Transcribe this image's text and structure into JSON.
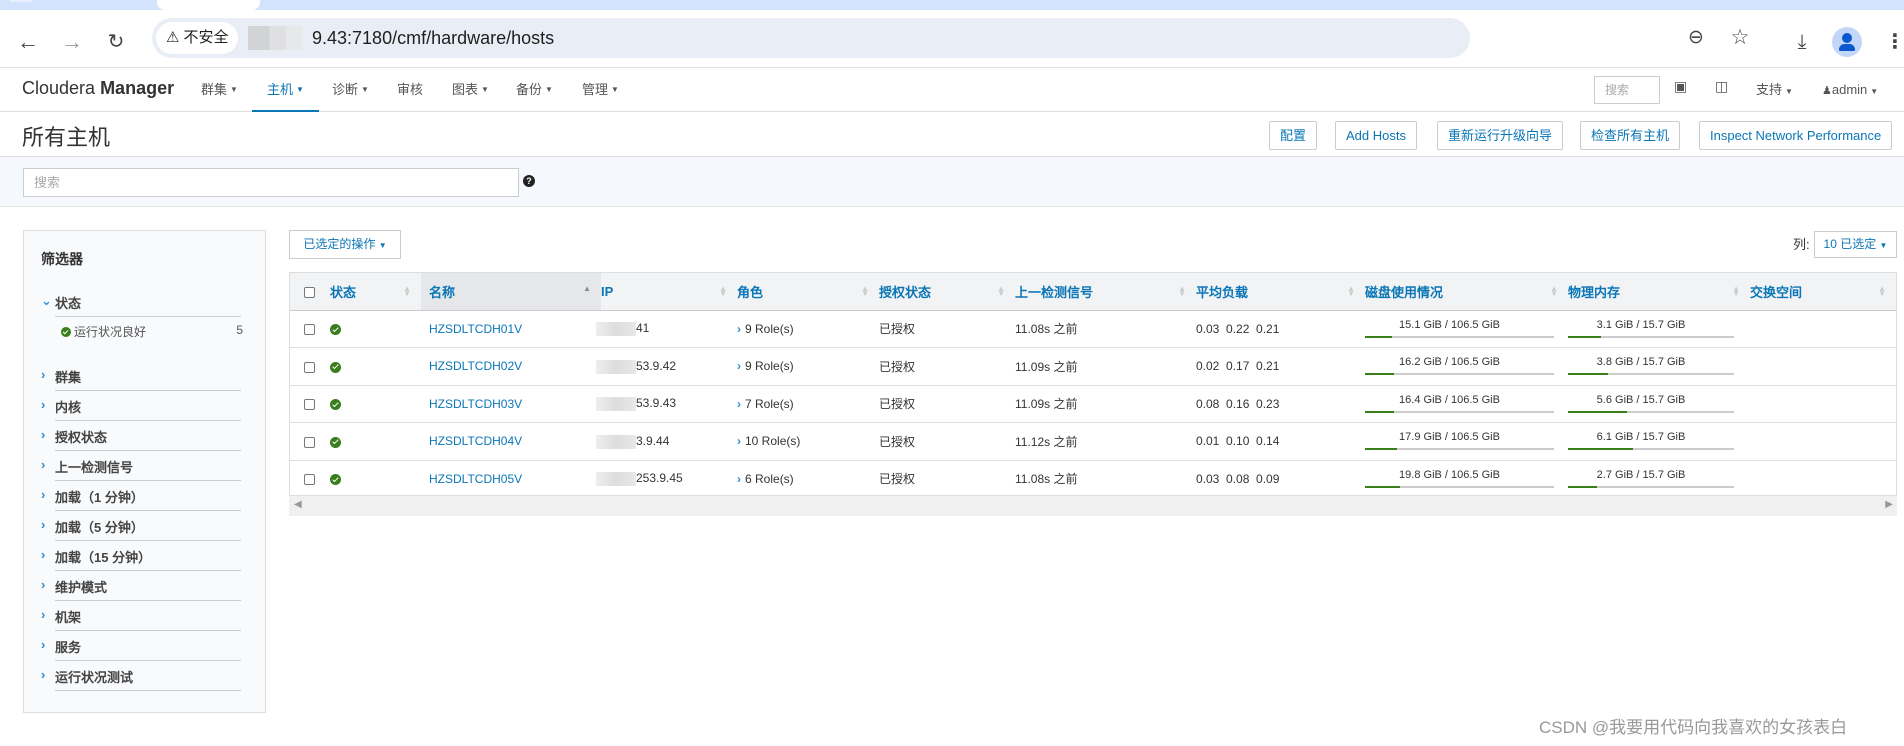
{
  "browser": {
    "security_label": "不安全",
    "url": "9.43:7180/cmf/hardware/hosts",
    "icons": [
      "back-icon",
      "forward-icon",
      "reload-icon",
      "warning-icon",
      "zoom-out-icon",
      "star-icon",
      "download-icon",
      "profile-icon",
      "more-menu-icon"
    ]
  },
  "nav": {
    "brand_light": "Cloudera",
    "brand_bold": "Manager",
    "menus": [
      {
        "label": "群集",
        "dropdown": true
      },
      {
        "label": "主机",
        "dropdown": true,
        "active": true
      },
      {
        "label": "诊断",
        "dropdown": true
      },
      {
        "label": "审核",
        "dropdown": false
      },
      {
        "label": "图表",
        "dropdown": true
      },
      {
        "label": "备份",
        "dropdown": true
      },
      {
        "label": "管理",
        "dropdown": true
      }
    ],
    "search_placeholder": "搜索",
    "support_label": "支持",
    "user_label": "admin",
    "accent_color": "#0a76b6"
  },
  "page": {
    "title": "所有主机",
    "buttons": [
      "配置",
      "Add Hosts",
      "重新运行升级向导",
      "检查所有主机",
      "Inspect Network Performance"
    ],
    "search_placeholder": "搜索",
    "help_glyph": "?"
  },
  "filters": {
    "title": "筛选器",
    "status_group": "状态",
    "status_item": {
      "label": "运行状况良好",
      "count": "5"
    },
    "groups": [
      "群集",
      "内核",
      "授权状态",
      "上一检测信号",
      "加载（1 分钟）",
      "加载（5 分钟）",
      "加载（15 分钟）",
      "维护模式",
      "机架",
      "服务",
      "运行状况测试"
    ]
  },
  "toolbar": {
    "actions_label": "已选定的操作",
    "columns_label": "列:",
    "columns_value": "10 已选定"
  },
  "table": {
    "headers": [
      "状态",
      "名称",
      "IP",
      "角色",
      "授权状态",
      "上一检测信号",
      "平均负载",
      "磁盘使用情况",
      "物理内存",
      "交换空间"
    ],
    "rows": [
      {
        "name": "HZSDLTCDH01V",
        "ip": "41",
        "roles": "9 Role(s)",
        "auth": "已授权",
        "heartbeat": "11.08s 之前",
        "load": "0.03  0.22  0.21",
        "disk": "15.1 GiB / 106.5 GiB",
        "disk_frac": 0.142,
        "mem": "3.1 GiB / 15.7 GiB",
        "mem_frac": 0.197
      },
      {
        "name": "HZSDLTCDH02V",
        "ip": "53.9.42",
        "roles": "9 Role(s)",
        "auth": "已授权",
        "heartbeat": "11.09s 之前",
        "load": "0.02  0.17  0.21",
        "disk": "16.2 GiB / 106.5 GiB",
        "disk_frac": 0.152,
        "mem": "3.8 GiB / 15.7 GiB",
        "mem_frac": 0.242
      },
      {
        "name": "HZSDLTCDH03V",
        "ip": "53.9.43",
        "roles": "7 Role(s)",
        "auth": "已授权",
        "heartbeat": "11.09s 之前",
        "load": "0.08  0.16  0.23",
        "disk": "16.4 GiB / 106.5 GiB",
        "disk_frac": 0.154,
        "mem": "5.6 GiB / 15.7 GiB",
        "mem_frac": 0.357
      },
      {
        "name": "HZSDLTCDH04V",
        "ip": "3.9.44",
        "roles": "10 Role(s)",
        "auth": "已授权",
        "heartbeat": "11.12s 之前",
        "load": "0.01  0.10  0.14",
        "disk": "17.9 GiB / 106.5 GiB",
        "disk_frac": 0.168,
        "mem": "6.1 GiB / 15.7 GiB",
        "mem_frac": 0.389
      },
      {
        "name": "HZSDLTCDH05V",
        "ip": "253.9.45",
        "roles": "6 Role(s)",
        "auth": "已授权",
        "heartbeat": "11.08s 之前",
        "load": "0.03  0.08  0.09",
        "disk": "19.8 GiB / 106.5 GiB",
        "disk_frac": 0.186,
        "mem": "2.7 GiB / 15.7 GiB",
        "mem_frac": 0.172
      }
    ],
    "healthy_color": "#3a7d1c"
  },
  "watermark": "CSDN @我要用代码向我喜欢的女孩表白"
}
